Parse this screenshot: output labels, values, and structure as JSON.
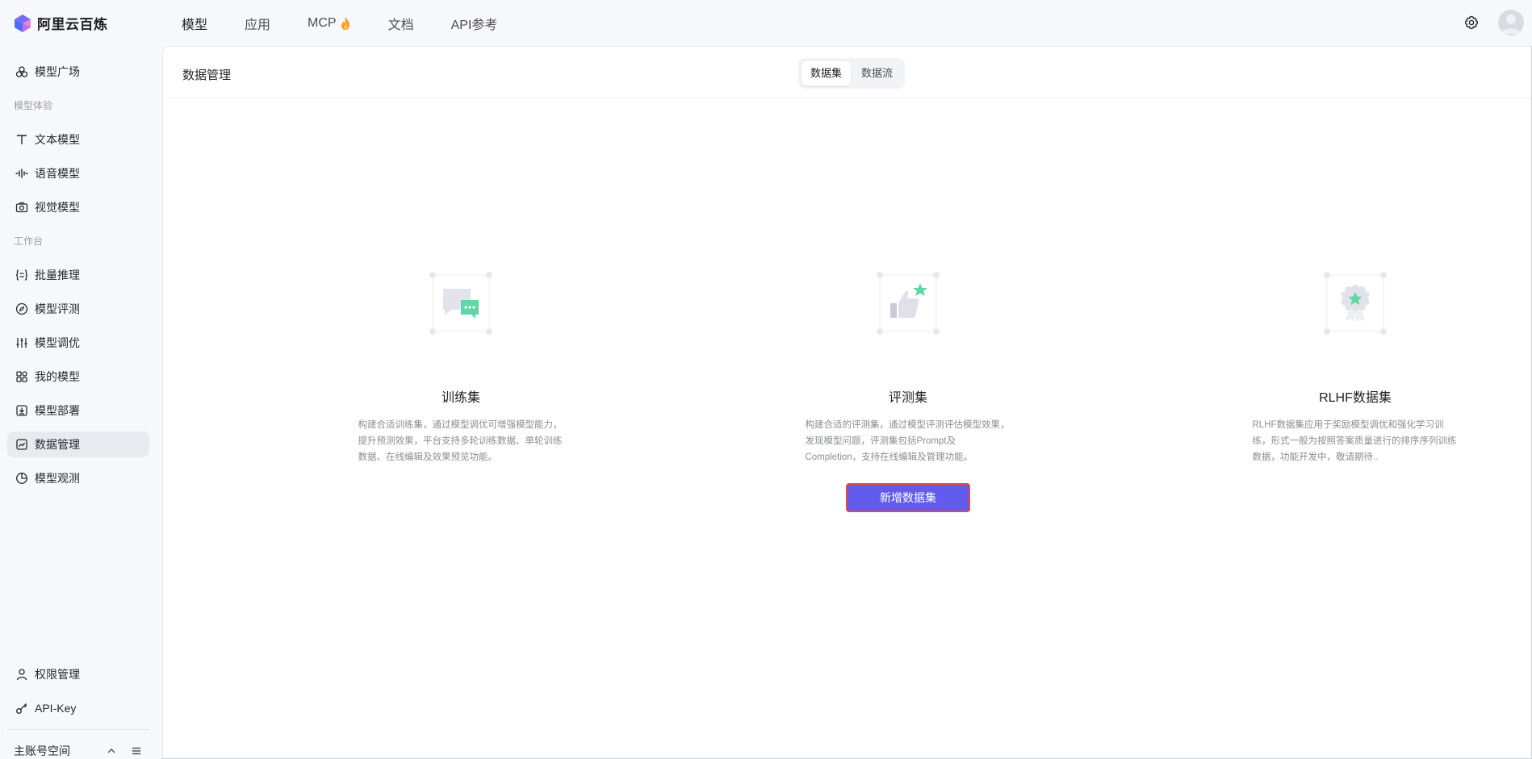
{
  "brand": {
    "name": "阿里云百炼"
  },
  "top_nav": [
    {
      "label": "模型",
      "active": true
    },
    {
      "label": "应用",
      "active": false
    },
    {
      "label": "MCP",
      "active": false,
      "icon": "flame-icon"
    },
    {
      "label": "文档",
      "active": false
    },
    {
      "label": "API参考",
      "active": false
    }
  ],
  "sidebar": {
    "model_plaza": "模型广场",
    "group_experience": "模型体验",
    "text_model": "文本模型",
    "voice_model": "语音模型",
    "vision_model": "视觉模型",
    "group_workbench": "工作台",
    "batch_inference": "批量推理",
    "model_eval": "模型评测",
    "model_tuning": "模型调优",
    "my_models": "我的模型",
    "model_deploy": "模型部署",
    "data_management": "数据管理",
    "model_observe": "模型观测",
    "permissions": "权限管理",
    "api_key": "API-Key",
    "workspace": "主账号空间"
  },
  "page": {
    "title": "数据管理",
    "tabs": [
      {
        "label": "数据集",
        "active": true
      },
      {
        "label": "数据流",
        "active": false
      }
    ]
  },
  "cards": [
    {
      "title": "训练集",
      "desc": "构建合适训练集，通过模型调优可增强模型能力，提升预测效果，平台支持多轮训练数据、单轮训练数据、在线编辑及效果预览功能。",
      "icon": "chat-bubbles-icon"
    },
    {
      "title": "评测集",
      "desc": "构建合适的评测集，通过模型评测评估模型效果，发现模型问题，评测集包括Prompt及Completion，支持在线编辑及管理功能。",
      "icon": "thumbs-up-star-icon",
      "button": "新增数据集"
    },
    {
      "title": "RLHF数据集",
      "desc": "RLHF数据集应用于奖励模型调优和强化学习训练，形式一般为按照答案质量进行的排序序列训练数据，功能开发中，敬请期待..",
      "icon": "badge-star-icon"
    }
  ],
  "colors": {
    "primary": "#615ced",
    "accent_green": "#4fd6a0",
    "highlight_border": "#e8483b"
  }
}
